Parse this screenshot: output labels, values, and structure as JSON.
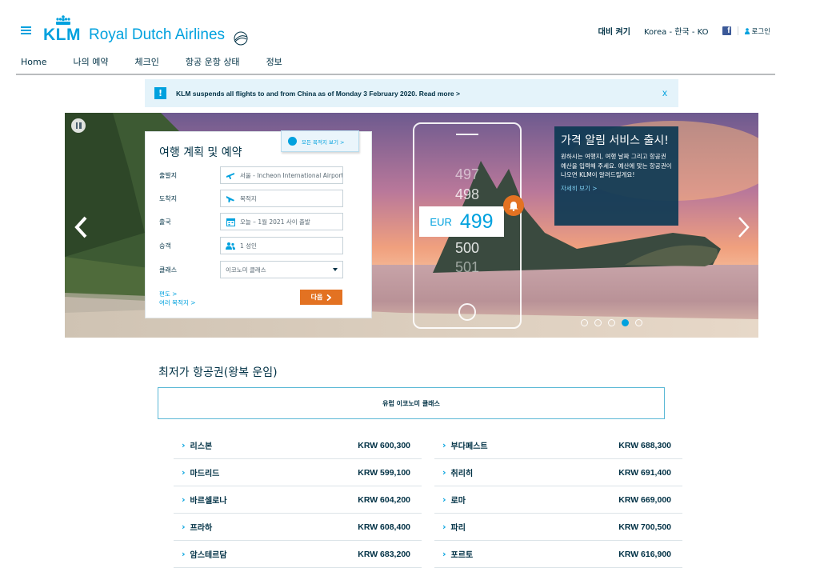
{
  "header": {
    "menu_icon": "hamburger-icon",
    "logo_mark": "KLM",
    "logo_text": "Royal Dutch Airlines",
    "contrast": "대비 켜기",
    "locale": "Korea - 한국 - KO",
    "facebook_icon": "facebook-icon",
    "login": "로그인"
  },
  "nav": {
    "items": [
      {
        "label": "Home"
      },
      {
        "label": "나의 예약"
      },
      {
        "label": "체크인"
      },
      {
        "label": "항공 운항 상태"
      },
      {
        "label": "정보"
      }
    ]
  },
  "notice": {
    "icon": "alert-icon",
    "text": "KLM suspends all flights to and from China as of Monday 3 February 2020. Read more >",
    "close": "x"
  },
  "booking": {
    "title": "여행 계획 및 예약",
    "all_destinations": "모든 목적지 보기 >",
    "fields": {
      "origin": {
        "label": "출발지",
        "value": "서울 - Incheon International Airport"
      },
      "destination": {
        "label": "도착지",
        "placeholder": "목적지"
      },
      "departure": {
        "label": "출국",
        "value": "오늘 – 1월 2021 사이 출발"
      },
      "passengers": {
        "label": "승객",
        "value": "1 성인"
      },
      "cabin": {
        "label": "클래스",
        "value": "이코노미 클래스"
      }
    },
    "one_way": "편도 >",
    "multi_city": "여러 목적지 >",
    "next": "다음"
  },
  "phone_promo": {
    "wheel_values": [
      "497",
      "498",
      "500",
      "501"
    ],
    "currency": "EUR",
    "price": "499"
  },
  "promo": {
    "title": "가격 알림 서비스 출시!",
    "body": "원하시는 여행지, 여행 날짜 그리고 항공권 예산을 입력해 주세요. 예산에 맞는 항공권이 나오면 KLM이 알려드릴게요!",
    "link": "자세히 보기 >"
  },
  "carousel": {
    "slides": 5,
    "active": 4
  },
  "fares": {
    "title": "최저가 항공권(왕복 운임)",
    "tab": "유럽 이코노미 클래스",
    "left": [
      {
        "city": "리스본",
        "price": "KRW 600,300"
      },
      {
        "city": "마드리드",
        "price": "KRW 599,100"
      },
      {
        "city": "바르셀로나",
        "price": "KRW 604,200"
      },
      {
        "city": "프라하",
        "price": "KRW 608,400"
      },
      {
        "city": "암스테르담",
        "price": "KRW 683,200"
      }
    ],
    "right": [
      {
        "city": "부다페스트",
        "price": "KRW 688,300"
      },
      {
        "city": "취리히",
        "price": "KRW 691,400"
      },
      {
        "city": "로마",
        "price": "KRW 669,000"
      },
      {
        "city": "파리",
        "price": "KRW 700,500"
      },
      {
        "city": "포르토",
        "price": "KRW 616,900"
      }
    ]
  },
  "colors": {
    "brand_blue": "#00a1de",
    "navy": "#003145",
    "orange": "#e37222"
  }
}
